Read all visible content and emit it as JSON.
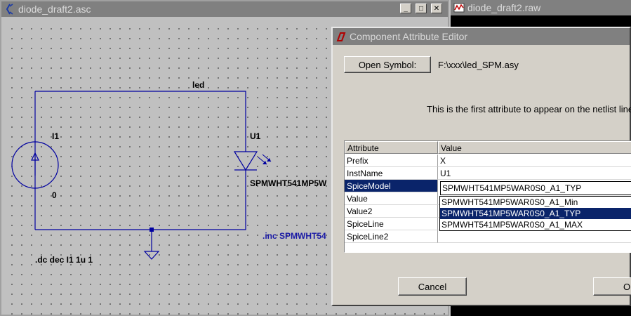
{
  "schematic_window": {
    "title": "diode_draft2.asc",
    "icon": "ltspice-schematic-icon",
    "net_label_led": "led",
    "source_name": "I1",
    "source_value": "0",
    "diode_name": "U1",
    "diode_value": "SPMWHT541MP5W",
    "directive_inc": ".inc SPMWHT54",
    "directive_dc": ".dc dec I1 1u 1",
    "wire_color": "#0000a0"
  },
  "raw_window": {
    "title": "diode_draft2.raw",
    "icon": "waveform-icon"
  },
  "dialog": {
    "title": "Component Attribute Editor",
    "open_symbol_label": "Open Symbol:",
    "symbol_path": "F:\\xxx\\led_SPM.asy",
    "hint": "This is the first attribute to appear on the netlist line",
    "table": {
      "headers": [
        "Attribute",
        "Value"
      ],
      "rows": [
        {
          "attr": "Prefix",
          "value": "X"
        },
        {
          "attr": "InstName",
          "value": "U1"
        },
        {
          "attr": "SpiceModel",
          "value": "SPMWHT541MP5WAR0S0_A1_TYP"
        },
        {
          "attr": "Value",
          "value": ""
        },
        {
          "attr": "Value2",
          "value": ""
        },
        {
          "attr": "SpiceLine",
          "value": ""
        },
        {
          "attr": "SpiceLine2",
          "value": ""
        }
      ]
    },
    "dropdown_options": [
      "SPMWHT541MP5WAR0S0_A1_Min",
      "SPMWHT541MP5WAR0S0_A1_TYP",
      "SPMWHT541MP5WAR0S0_A1_MAX"
    ],
    "cancel_label": "Cancel",
    "ok_label": "Ok"
  },
  "colors": {
    "selection": "#0a246a",
    "directive_blue": "#1a1aa6"
  }
}
